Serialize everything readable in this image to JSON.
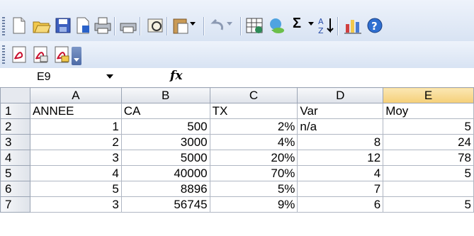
{
  "name_box": "E9",
  "formula_label": "fx",
  "toolbar": {
    "icons": [
      "new-icon",
      "open-icon",
      "save-icon",
      "permission-icon",
      "print-icon",
      "print-preview-icon",
      "research-icon",
      "paste-icon",
      "undo-icon",
      "autosum-icon",
      "sort-icon",
      "chart-icon",
      "help-icon"
    ],
    "autosum_glyph": "Σ",
    "pdf_icons": [
      "pdf-convert-icon",
      "pdf-email-icon",
      "pdf-review-icon"
    ]
  },
  "columns": [
    "A",
    "B",
    "C",
    "D",
    "E"
  ],
  "rows": [
    "1",
    "2",
    "3",
    "4",
    "5",
    "6",
    "7"
  ],
  "cells": [
    [
      {
        "v": "ANNEE",
        "a": "txt"
      },
      {
        "v": "CA",
        "a": "txt"
      },
      {
        "v": "TX",
        "a": "txt"
      },
      {
        "v": "Var",
        "a": "txt"
      },
      {
        "v": "Moy",
        "a": "txt"
      }
    ],
    [
      {
        "v": "1",
        "a": "num"
      },
      {
        "v": "500",
        "a": "num"
      },
      {
        "v": "2%",
        "a": "num"
      },
      {
        "v": "n/a",
        "a": "txt"
      },
      {
        "v": "5",
        "a": "num"
      }
    ],
    [
      {
        "v": "2",
        "a": "num"
      },
      {
        "v": "3000",
        "a": "num"
      },
      {
        "v": "4%",
        "a": "num"
      },
      {
        "v": "8",
        "a": "num"
      },
      {
        "v": "24",
        "a": "num"
      }
    ],
    [
      {
        "v": "3",
        "a": "num"
      },
      {
        "v": "5000",
        "a": "num"
      },
      {
        "v": "20%",
        "a": "num"
      },
      {
        "v": "12",
        "a": "num"
      },
      {
        "v": "78",
        "a": "num"
      }
    ],
    [
      {
        "v": "4",
        "a": "num"
      },
      {
        "v": "40000",
        "a": "num"
      },
      {
        "v": "70%",
        "a": "num"
      },
      {
        "v": "4",
        "a": "num"
      },
      {
        "v": "5",
        "a": "num"
      }
    ],
    [
      {
        "v": "5",
        "a": "num"
      },
      {
        "v": "8896",
        "a": "num"
      },
      {
        "v": "5%",
        "a": "num"
      },
      {
        "v": "7",
        "a": "num"
      },
      {
        "v": "",
        "a": "num"
      }
    ],
    [
      {
        "v": "3",
        "a": "num"
      },
      {
        "v": "56745",
        "a": "num"
      },
      {
        "v": "9%",
        "a": "num"
      },
      {
        "v": "6",
        "a": "num"
      },
      {
        "v": "5",
        "a": "num"
      }
    ]
  ],
  "selected_column": "E"
}
